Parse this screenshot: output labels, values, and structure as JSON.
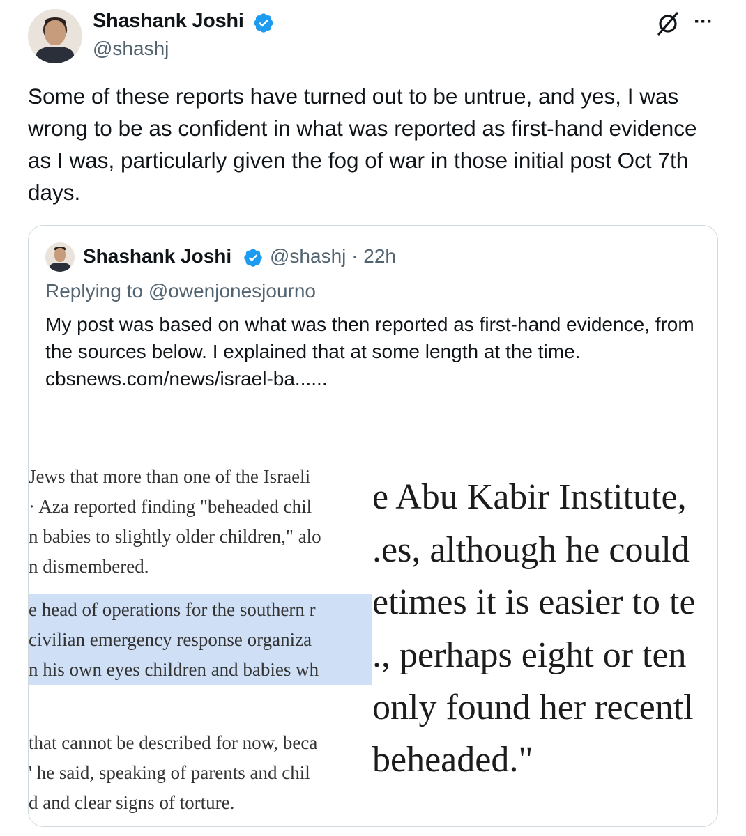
{
  "author": {
    "name": "Shashank Joshi",
    "handle": "@shashj"
  },
  "tweet": {
    "text": "Some of these reports have turned out to be untrue, and yes, I was wrong to be as confident in what was reported as first-hand evidence as I was, particularly given the fog of war in those initial post Oct 7th days."
  },
  "quoted": {
    "name": "Shashank Joshi",
    "handle_time": "@shashj · 22h",
    "replying_to": "Replying to @owenjonesjourno",
    "text": "My post was based on what was then reported as first-hand evidence, from the sources below. I explained that at some length at the time.",
    "link": "cbsnews.com/news/israel-ba......",
    "image": {
      "left_lines": [
        "Jews that more than one of the Israeli",
        "· Aza reported finding \"beheaded chil",
        "n babies to slightly older children,\" alo",
        "n dismembered.",
        "e head of operations for the southern r",
        " civilian emergency response organiza",
        "n his own eyes children and babies wh",
        "that cannot be described for now, beca",
        "' he said, speaking of parents and chil",
        "d and clear signs of torture."
      ],
      "right_lines": [
        "e Abu Kabir Institute,",
        ".es, although he could",
        "etimes it is easier to te",
        "., perhaps eight or ten",
        "only found her recentl",
        "beheaded.\""
      ]
    }
  },
  "colors": {
    "verified": "#1d9bf0",
    "secondary_text": "#536471",
    "highlight": "#cfe0f6"
  },
  "icons": [
    "verified-badge-icon",
    "grok-icon",
    "more-icon"
  ]
}
